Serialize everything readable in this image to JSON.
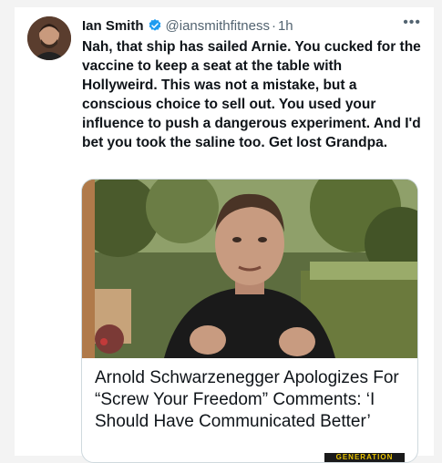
{
  "tweet": {
    "author_name": "Ian Smith",
    "handle": "@iansmithfitness",
    "separator": "·",
    "time": "1h",
    "more_icon": "more-horizontal-icon",
    "verified_color": "#1d9bf0",
    "text": "Nah, that ship has sailed Arnie. You cucked for the vaccine to keep a seat at the table with Hollyweird. This was not a mistake, but a conscious choice to sell out. You used your influence to push a dangerous experiment. And I'd bet you took the saline too. Get lost Grandpa."
  },
  "card": {
    "title": "Arnold Schwarzenegger Apologizes For “Screw Your Freedom” Comments: ‘I Should Have Communicated Better’",
    "watermark_text": "GENERATION"
  }
}
